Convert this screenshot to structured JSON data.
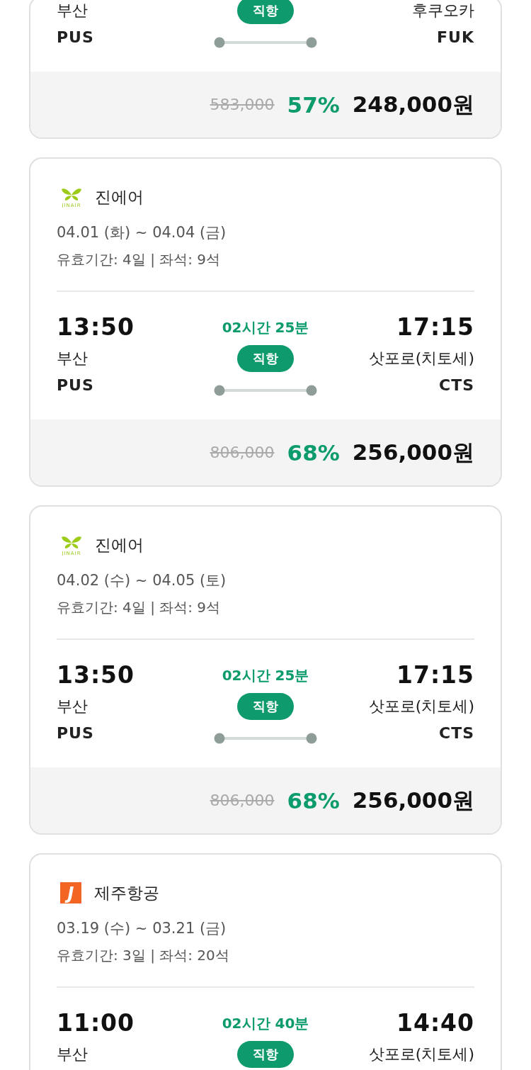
{
  "flights": [
    {
      "origin": {
        "city": "부산",
        "code": "PUS"
      },
      "destination": {
        "city": "후쿠오카",
        "code": "FUK"
      },
      "direct_label": "직항",
      "price": {
        "original": "583,000",
        "discount": "57%",
        "final": "248,000원"
      }
    },
    {
      "airline": {
        "name": "진에어",
        "kind": "jinair",
        "logo_text": "JINAIR"
      },
      "dates": "04.01 (화) ~ 04.04 (금)",
      "validity": "유효기간: 4일 | 좌석: 9석",
      "departure_time": "13:50",
      "duration": "02시간 25분",
      "arrival_time": "17:15",
      "origin": {
        "city": "부산",
        "code": "PUS"
      },
      "destination": {
        "city": "삿포로(치토세)",
        "code": "CTS"
      },
      "direct_label": "직항",
      "price": {
        "original": "806,000",
        "discount": "68%",
        "final": "256,000원"
      }
    },
    {
      "airline": {
        "name": "진에어",
        "kind": "jinair",
        "logo_text": "JINAIR"
      },
      "dates": "04.02 (수) ~ 04.05 (토)",
      "validity": "유효기간: 4일 | 좌석: 9석",
      "departure_time": "13:50",
      "duration": "02시간 25분",
      "arrival_time": "17:15",
      "origin": {
        "city": "부산",
        "code": "PUS"
      },
      "destination": {
        "city": "삿포로(치토세)",
        "code": "CTS"
      },
      "direct_label": "직항",
      "price": {
        "original": "806,000",
        "discount": "68%",
        "final": "256,000원"
      }
    },
    {
      "airline": {
        "name": "제주항공",
        "kind": "jeju",
        "logo_text": "J"
      },
      "dates": "03.19 (수) ~ 03.21 (금)",
      "validity": "유효기간: 3일 | 좌석: 20석",
      "departure_time": "11:00",
      "duration": "02시간 40분",
      "arrival_time": "14:40",
      "origin": {
        "city": "부산"
      },
      "destination": {
        "city": "삿포로(치토세)"
      },
      "direct_label": "직항"
    }
  ]
}
